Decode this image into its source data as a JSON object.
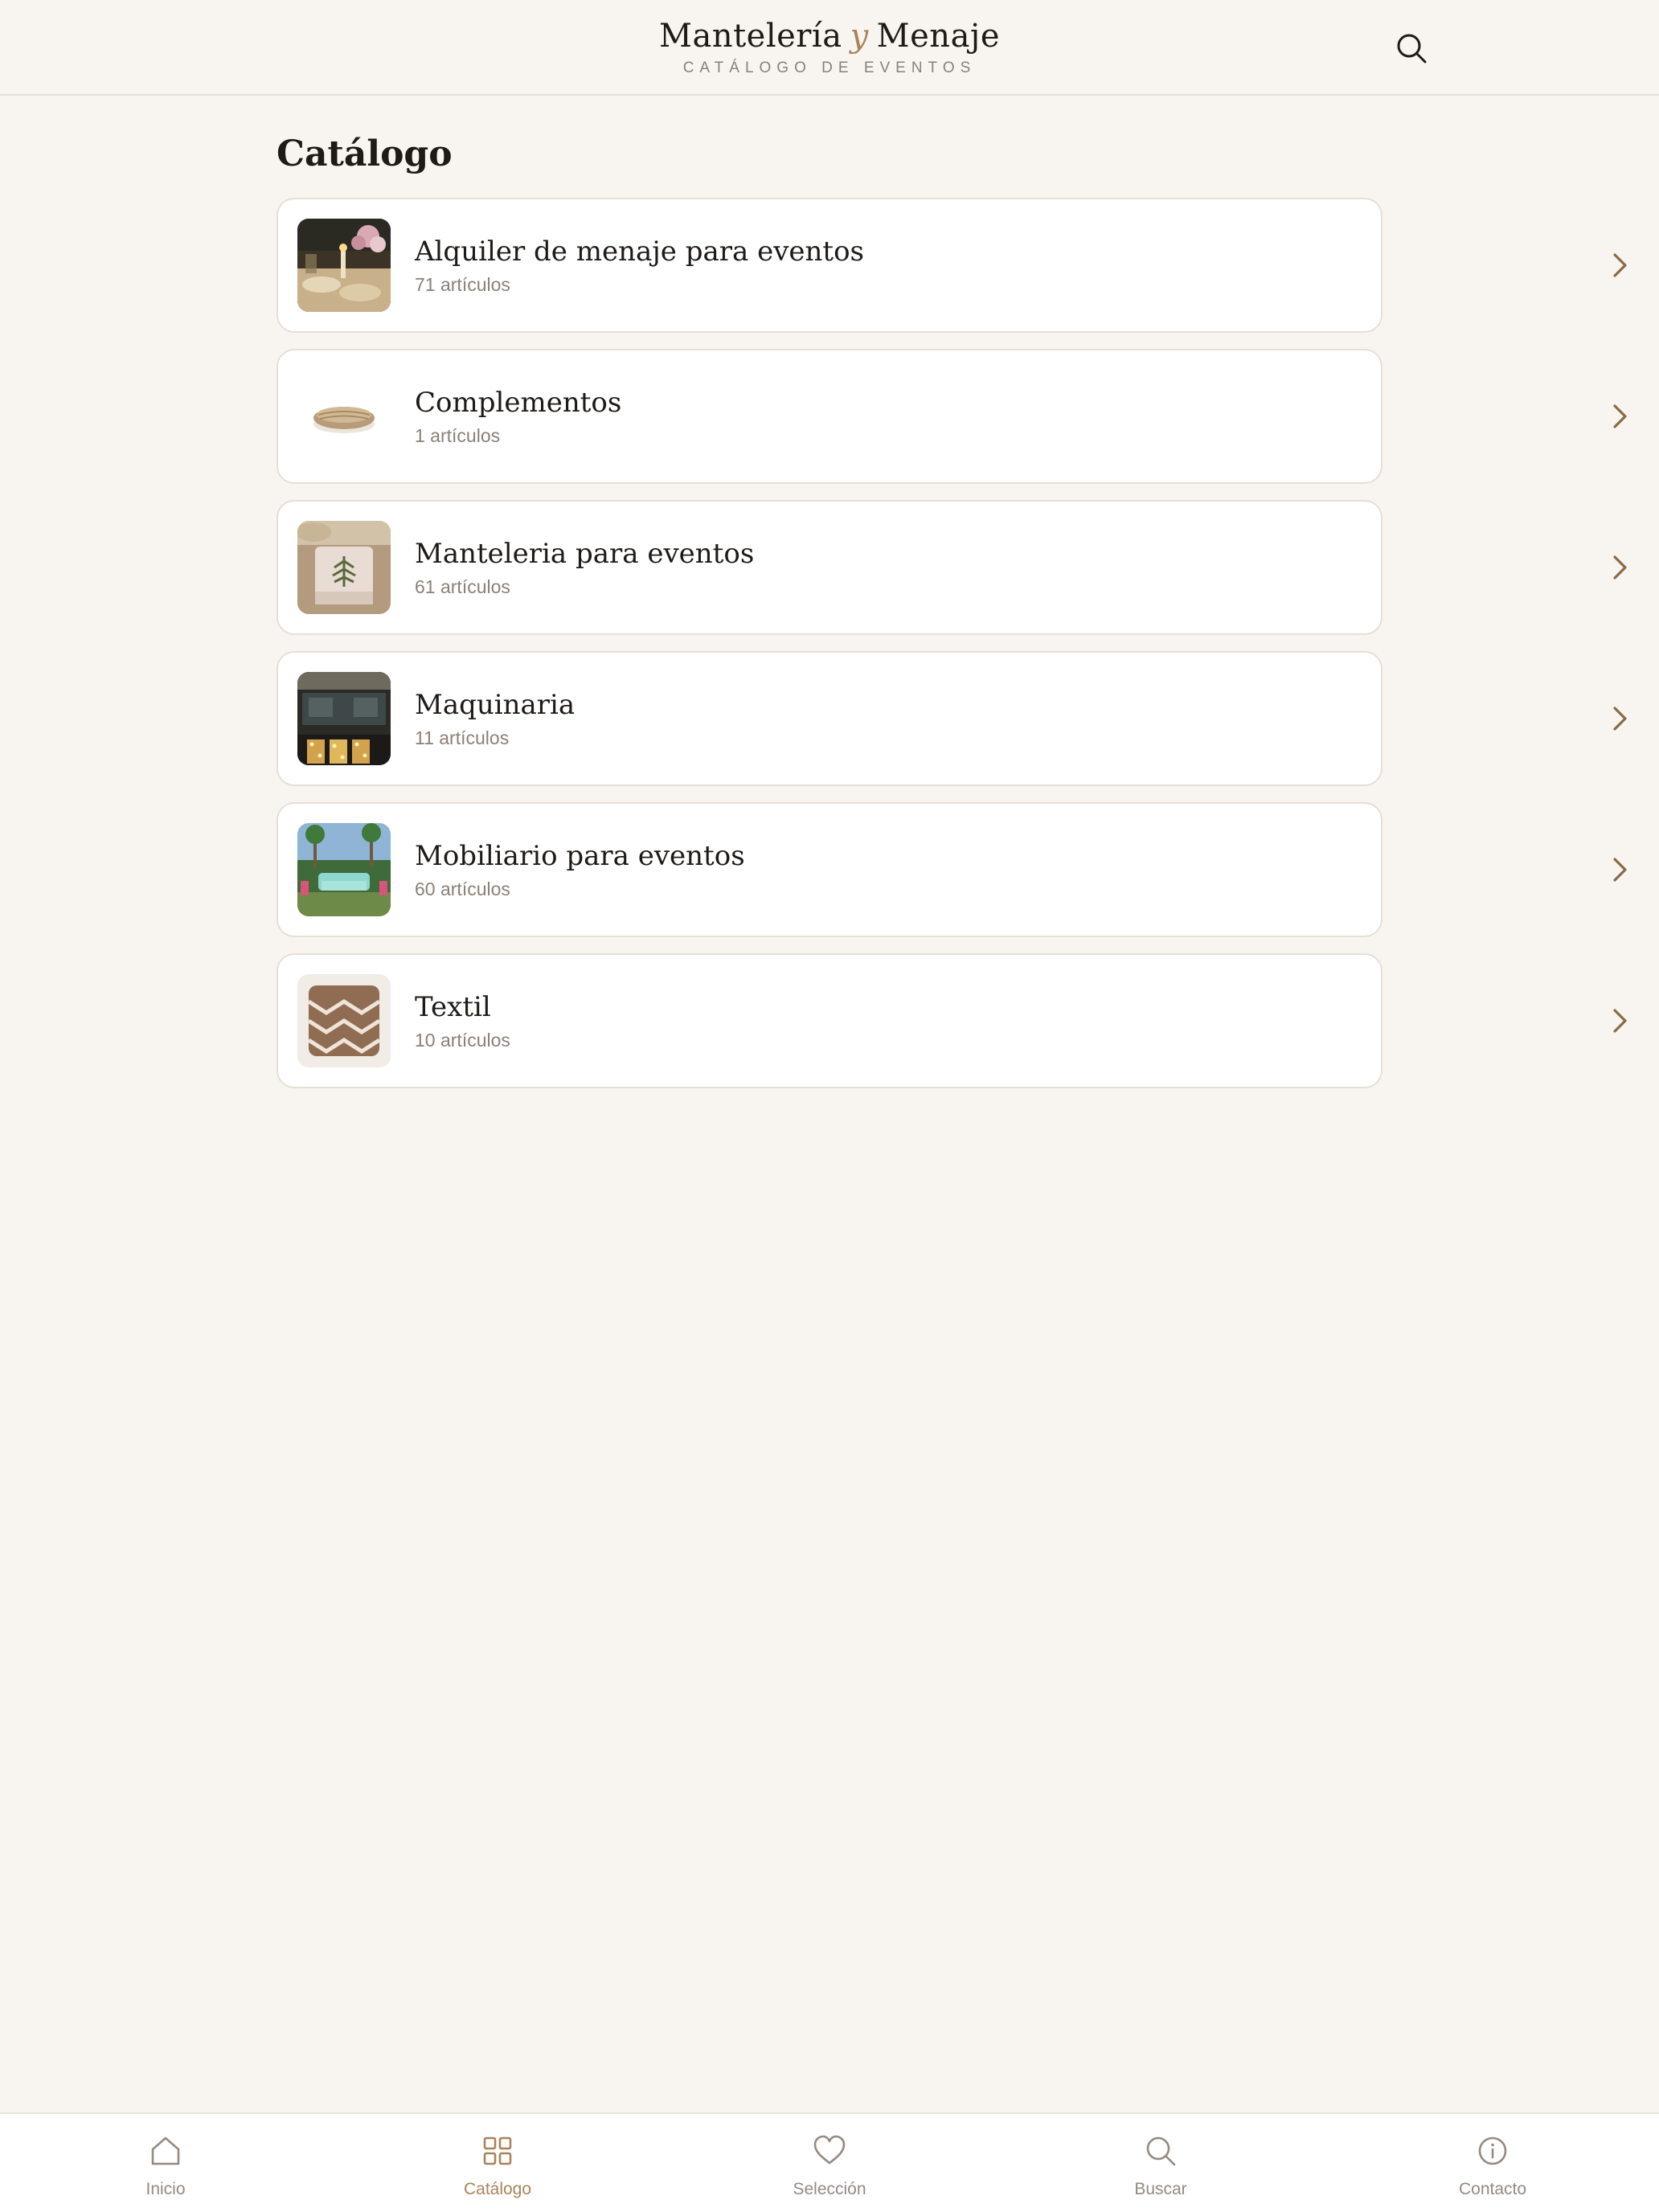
{
  "header": {
    "brand_left": "Mantelería",
    "brand_amp": "y",
    "brand_right": "Menaje",
    "subtitle": "CATÁLOGO DE EVENTOS",
    "search_icon": "search-icon"
  },
  "page": {
    "title": "Catálogo"
  },
  "categories": [
    {
      "name": "Alquiler de menaje para eventos",
      "count": "71 artículos",
      "thumb": "table-setting-photo"
    },
    {
      "name": "Complementos",
      "count": "1 artículos",
      "thumb": "woven-basket-photo"
    },
    {
      "name": "Manteleria para eventos",
      "count": "61 artículos",
      "thumb": "napkin-photo"
    },
    {
      "name": "Maquinaria",
      "count": "11 artículos",
      "thumb": "bar-sign-photo"
    },
    {
      "name": "Mobiliario para eventos",
      "count": "60 artículos",
      "thumb": "garden-sofa-photo"
    },
    {
      "name": "Textil",
      "count": "10 artículos",
      "thumb": "cushion-photo"
    }
  ],
  "bottom_nav": {
    "active": "Catálogo",
    "items": [
      {
        "label": "Inicio",
        "icon": "home-icon"
      },
      {
        "label": "Catálogo",
        "icon": "grid-icon"
      },
      {
        "label": "Selección",
        "icon": "heart-icon"
      },
      {
        "label": "Buscar",
        "icon": "search-icon"
      },
      {
        "label": "Contacto",
        "icon": "info-icon"
      }
    ]
  },
  "colors": {
    "background": "#f8f5f0",
    "accent": "#a8845a",
    "text": "#1e1a16",
    "muted": "#8b8076",
    "card_border": "#e6dfd5"
  }
}
